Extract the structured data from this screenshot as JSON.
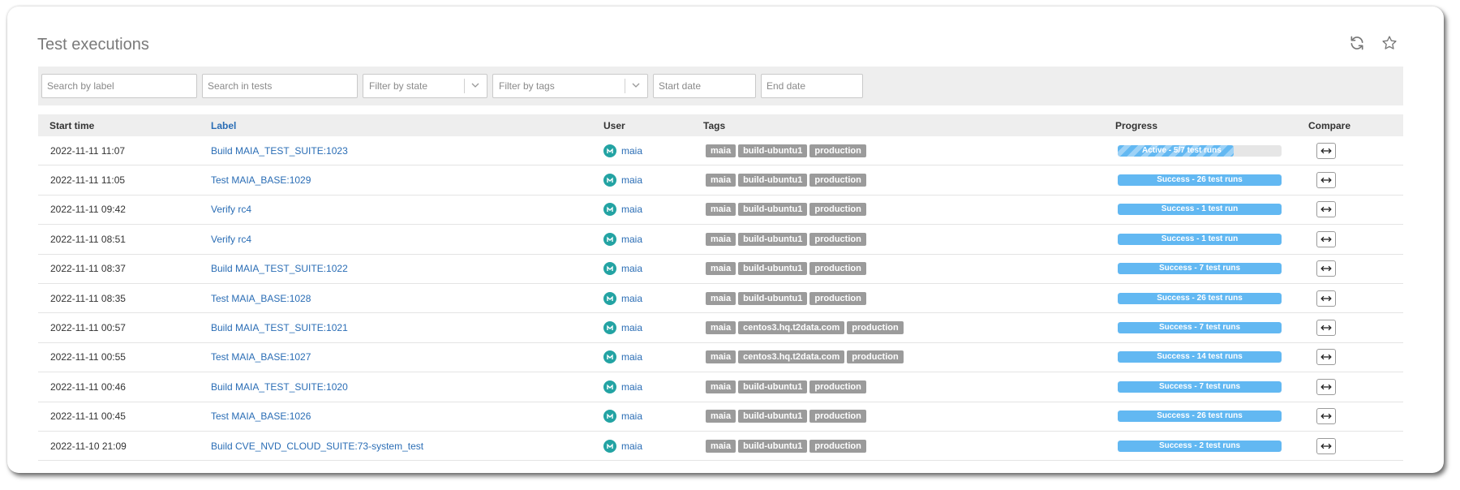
{
  "page": {
    "title": "Test executions"
  },
  "icons": {
    "refresh": "refresh-icon",
    "favorite": "star-icon",
    "dropdown": "chevron-down-icon",
    "compare": "arrows-horizontal-icon",
    "user": "user-avatar-icon"
  },
  "colors": {
    "link": "#2a6db5",
    "tag_bg": "#9b9b9b",
    "progress": "#62b8f2",
    "avatar": "#23a3a3"
  },
  "filters": {
    "search_label_placeholder": "Search by label",
    "search_tests_placeholder": "Search in tests",
    "state_placeholder": "Filter by state",
    "tags_placeholder": "Filter by tags",
    "start_date_placeholder": "Start date",
    "end_date_placeholder": "End date"
  },
  "columns": {
    "start_time": "Start time",
    "label": "Label",
    "user": "User",
    "tags": "Tags",
    "progress": "Progress",
    "compare": "Compare"
  },
  "rows": [
    {
      "start_time": "2022-11-11 11:07",
      "label": "Build MAIA_TEST_SUITE:1023",
      "user": "maia",
      "tags": [
        "maia",
        "build-ubuntu1",
        "production"
      ],
      "progress_text": "Active - 5/7 test runs",
      "progress_fraction": 0.71,
      "state": "active"
    },
    {
      "start_time": "2022-11-11 11:05",
      "label": "Test MAIA_BASE:1029",
      "user": "maia",
      "tags": [
        "maia",
        "build-ubuntu1",
        "production"
      ],
      "progress_text": "Success - 26 test runs",
      "progress_fraction": 1,
      "state": "success"
    },
    {
      "start_time": "2022-11-11 09:42",
      "label": "Verify rc4",
      "user": "maia",
      "tags": [
        "maia",
        "build-ubuntu1",
        "production"
      ],
      "progress_text": "Success - 1 test run",
      "progress_fraction": 1,
      "state": "success"
    },
    {
      "start_time": "2022-11-11 08:51",
      "label": "Verify rc4",
      "user": "maia",
      "tags": [
        "maia",
        "build-ubuntu1",
        "production"
      ],
      "progress_text": "Success - 1 test run",
      "progress_fraction": 1,
      "state": "success"
    },
    {
      "start_time": "2022-11-11 08:37",
      "label": "Build MAIA_TEST_SUITE:1022",
      "user": "maia",
      "tags": [
        "maia",
        "build-ubuntu1",
        "production"
      ],
      "progress_text": "Success - 7 test runs",
      "progress_fraction": 1,
      "state": "success"
    },
    {
      "start_time": "2022-11-11 08:35",
      "label": "Test MAIA_BASE:1028",
      "user": "maia",
      "tags": [
        "maia",
        "build-ubuntu1",
        "production"
      ],
      "progress_text": "Success - 26 test runs",
      "progress_fraction": 1,
      "state": "success"
    },
    {
      "start_time": "2022-11-11 00:57",
      "label": "Build MAIA_TEST_SUITE:1021",
      "user": "maia",
      "tags": [
        "maia",
        "centos3.hq.t2data.com",
        "production"
      ],
      "progress_text": "Success - 7 test runs",
      "progress_fraction": 1,
      "state": "success"
    },
    {
      "start_time": "2022-11-11 00:55",
      "label": "Test MAIA_BASE:1027",
      "user": "maia",
      "tags": [
        "maia",
        "centos3.hq.t2data.com",
        "production"
      ],
      "progress_text": "Success - 14 test runs",
      "progress_fraction": 1,
      "state": "success"
    },
    {
      "start_time": "2022-11-11 00:46",
      "label": "Build MAIA_TEST_SUITE:1020",
      "user": "maia",
      "tags": [
        "maia",
        "build-ubuntu1",
        "production"
      ],
      "progress_text": "Success - 7 test runs",
      "progress_fraction": 1,
      "state": "success"
    },
    {
      "start_time": "2022-11-11 00:45",
      "label": "Test MAIA_BASE:1026",
      "user": "maia",
      "tags": [
        "maia",
        "build-ubuntu1",
        "production"
      ],
      "progress_text": "Success - 26 test runs",
      "progress_fraction": 1,
      "state": "success"
    },
    {
      "start_time": "2022-11-10 21:09",
      "label": "Build CVE_NVD_CLOUD_SUITE:73-system_test",
      "user": "maia",
      "tags": [
        "maia",
        "build-ubuntu1",
        "production"
      ],
      "progress_text": "Success - 2 test runs",
      "progress_fraction": 1,
      "state": "success"
    }
  ]
}
